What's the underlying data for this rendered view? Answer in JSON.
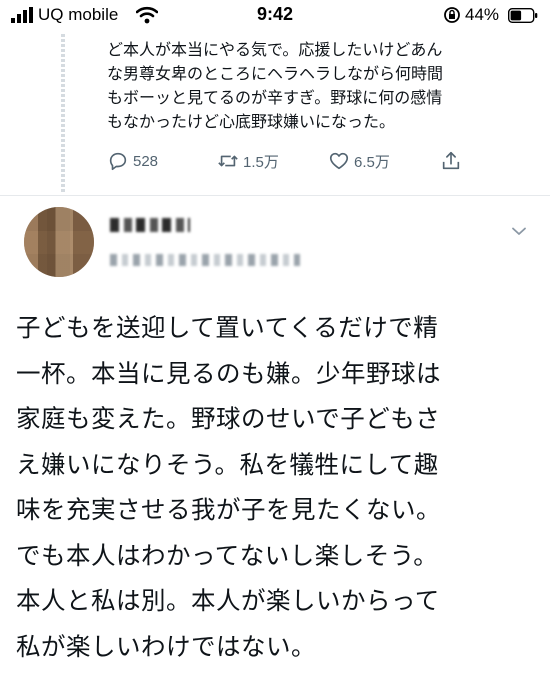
{
  "status_bar": {
    "carrier": "UQ mobile",
    "time": "9:42",
    "battery_percent": "44%"
  },
  "parent_tweet": {
    "text_lines": [
      "ど本人が本当にやる気で。応援したいけどあん",
      "な男尊女卑のところにヘラヘラしながら何時間",
      "もボーッと見てるのが辛すぎ。野球に何の感情",
      "もなかったけど心底野球嫌いになった。"
    ],
    "replies": "528",
    "retweets": "1.5万",
    "likes": "6.5万"
  },
  "reply": {
    "text_lines": [
      "子どもを送迎して置いてくるだけで精",
      "一杯。本当に見るのも嫌。少年野球は",
      "家庭も変えた。野球のせいで子どもさ",
      "え嫌いになりそう。私を犠牲にして趣",
      "味を充実させる我が子を見たくない。",
      "でも本人はわかってないし楽しそう。",
      "本人と私は別。本人が楽しいからって",
      "私が楽しいわけではない。"
    ]
  },
  "colors": {
    "text": "#0f1419",
    "secondary": "#536471",
    "divider": "#e6e9ec"
  },
  "icons": [
    "signal-icon",
    "wifi-icon",
    "rotation-lock-icon",
    "battery-icon",
    "reply-icon",
    "retweet-icon",
    "like-icon",
    "share-icon",
    "chevron-down-icon"
  ]
}
